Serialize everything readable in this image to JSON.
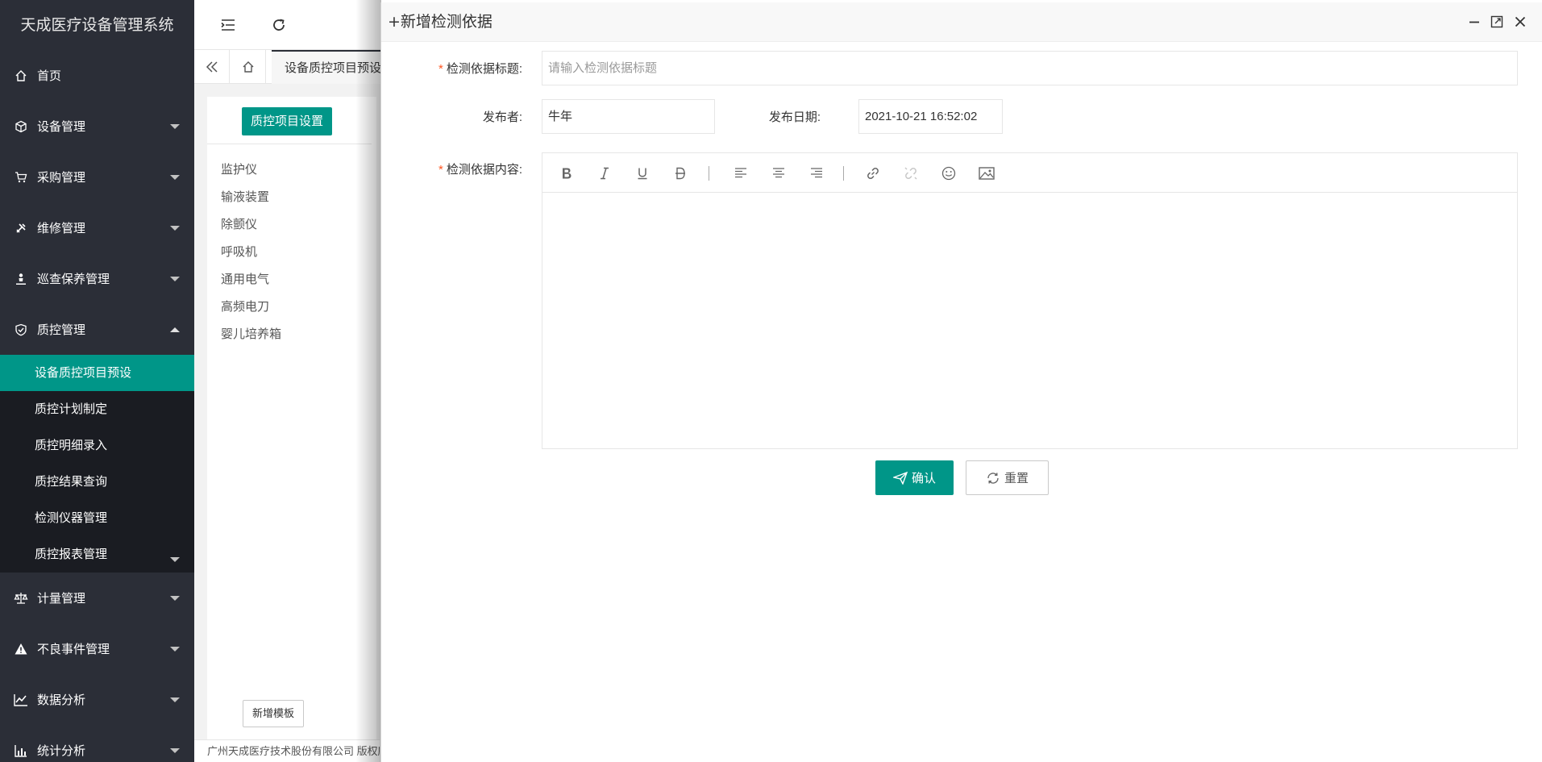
{
  "app": {
    "title": "天成医疗设备管理系统"
  },
  "sidebar": {
    "items": [
      {
        "label": "首页",
        "icon": "home-icon"
      },
      {
        "label": "设备管理",
        "icon": "cube-icon"
      },
      {
        "label": "采购管理",
        "icon": "cart-icon"
      },
      {
        "label": "维修管理",
        "icon": "tools-icon"
      },
      {
        "label": "巡查保养管理",
        "icon": "person-icon"
      },
      {
        "label": "质控管理",
        "icon": "shield-check-icon"
      }
    ],
    "submenu": [
      {
        "label": "设备质控项目预设",
        "active": true
      },
      {
        "label": "质控计划制定"
      },
      {
        "label": "质控明细录入"
      },
      {
        "label": "质控结果查询"
      },
      {
        "label": "检测仪器管理"
      },
      {
        "label": "质控报表管理"
      }
    ],
    "items_after": [
      {
        "label": "计量管理",
        "icon": "scale-icon"
      },
      {
        "label": "不良事件管理",
        "icon": "warning-icon"
      },
      {
        "label": "数据分析",
        "icon": "line-chart-icon"
      },
      {
        "label": "统计分析",
        "icon": "bar-chart-icon"
      }
    ]
  },
  "tabs": {
    "current": "设备质控项目预设"
  },
  "page": {
    "qc_button": "质控项目设置",
    "categories": [
      "监护仪",
      "输液装置",
      "除颤仪",
      "呼吸机",
      "通用电气",
      "高频电刀",
      "婴儿培养箱"
    ],
    "add_template": "新增模板",
    "footer": "广州天成医疗技术股份有限公司 版权所有"
  },
  "modal": {
    "title": "+新增检测依据",
    "form": {
      "title_label": "检测依据标题:",
      "title_placeholder": "请输入检测依据标题",
      "publisher_label": "发布者:",
      "publisher_value": "牛年",
      "date_label": "发布日期:",
      "date_value": "2021-10-21 16:52:02",
      "content_label": "检测依据内容:"
    },
    "confirm_label": "确认",
    "reset_label": "重置"
  },
  "colors": {
    "accent": "#009688",
    "sidebar_bg": "#2b2e37",
    "submenu_bg": "#1a1c22",
    "required": "#ff5722"
  }
}
